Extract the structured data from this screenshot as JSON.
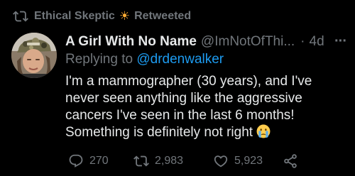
{
  "retweet_header": {
    "user": "Ethical Skeptic",
    "sun_emoji": "☀",
    "label": "Retweeted"
  },
  "tweet": {
    "display_name": "A Girl With No Name",
    "handle": "@ImNotOfThi...",
    "separator": "·",
    "time": "4d",
    "replying_prefix": "Replying to",
    "replying_to": "@drdenwalker",
    "lines": [
      "I'm a mammographer (30 years), and I've",
      "never seen anything like the aggressive",
      "cancers I've seen in the last 6 months!",
      "Something is definitely not right"
    ],
    "trailing_emoji": "crying-face-emoji"
  },
  "actions": {
    "reply_count": "270",
    "retweet_count": "2,983",
    "like_count": "5,923"
  },
  "colors": {
    "background": "#000000",
    "text": "#e7e9ea",
    "muted": "#71767b",
    "link": "#1d9bf0"
  }
}
